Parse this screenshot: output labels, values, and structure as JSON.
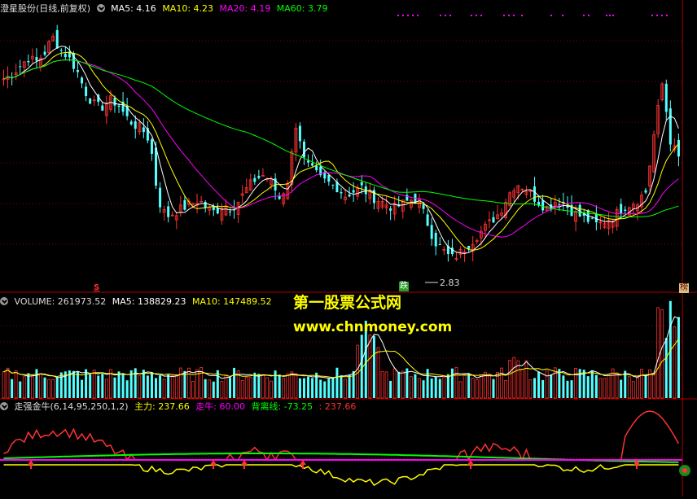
{
  "main": {
    "title": "澄星股份(日线,前复权)",
    "ma5": "MA5: 4.16",
    "ma10": "MA10: 4.23",
    "ma20": "MA20: 4.19",
    "ma60": "MA60: 3.79",
    "low_label": "2.83",
    "tag_die": "跌",
    "tag_bang": "榜",
    "tag_s": "S"
  },
  "volume": {
    "title": "VOLUME: 261973.52",
    "ma5": "MA5: 138829.23",
    "ma10": "MA10: 147489.52"
  },
  "indicator": {
    "title": "走强金牛(6,14,95,250,1,2)",
    "zhuli": "主力: 237.66",
    "zouniu": "走牛: 60.00",
    "beili_label": "背离线:",
    "beili_value": "-73.25",
    "extra": ": 237.66"
  },
  "watermark": {
    "line1": "第一股票公式网",
    "line2": "www.chnmoney.com"
  },
  "colors": {
    "up": "#ff3232",
    "down": "#54ffff",
    "ma5": "#ffffff",
    "ma10": "#ffff00",
    "ma20": "#ff00ff",
    "ma60": "#00ff00",
    "grid": "#7a0000"
  },
  "chart_data": [
    {
      "type": "candlestick",
      "title": "澄星股份(日线,前复权)",
      "low_annotation": 2.83,
      "ma_current": {
        "MA5": 4.16,
        "MA10": 4.23,
        "MA20": 4.19,
        "MA60": 3.79
      },
      "close_path": [
        5.05,
        5.1,
        5.2,
        5.3,
        5.25,
        5.35,
        5.55,
        5.4,
        5.3,
        5.15,
        4.9,
        4.75,
        4.7,
        4.8,
        4.75,
        4.6,
        4.5,
        4.45,
        4.3,
        3.6,
        3.4,
        3.45,
        3.5,
        3.55,
        3.6,
        3.5,
        3.45,
        3.55,
        3.5,
        3.6,
        3.75,
        3.85,
        3.9,
        3.8,
        3.6,
        3.85,
        4.55,
        4.05,
        3.95,
        3.85,
        3.8,
        3.75,
        3.65,
        3.7,
        3.75,
        3.65,
        3.6,
        3.55,
        3.5,
        3.55,
        3.6,
        3.6,
        3.35,
        3.1,
        3.0,
        2.9,
        2.95,
        3.05,
        3.15,
        3.25,
        3.35,
        3.45,
        3.65,
        3.8,
        3.75,
        3.65,
        3.55,
        3.5,
        3.6,
        3.55,
        3.45,
        3.4,
        3.35,
        3.3,
        3.35,
        3.4,
        3.5,
        3.55,
        3.6,
        3.7,
        4.4,
        5.0,
        4.3,
        4.1
      ]
    },
    {
      "type": "bar",
      "title": "VOLUME: 261973.52",
      "current": 261973.52,
      "ma_current": {
        "MA5": 138829.23,
        "MA10": 147489.52
      }
    },
    {
      "type": "line",
      "title": "走强金牛(6,14,95,250,1,2)",
      "series_current": {
        "主力": 237.66,
        "走牛": 60.0,
        "背离线": -73.25
      }
    }
  ]
}
